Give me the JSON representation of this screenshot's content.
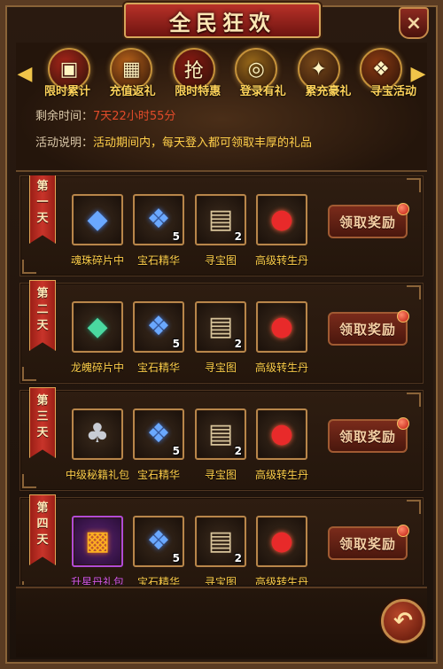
{
  "title": "全民狂欢",
  "close_glyph": "×",
  "nav": {
    "prev_glyph": "◀",
    "next_glyph": "▶"
  },
  "activities": [
    {
      "label": "限时累计",
      "icon": "chest-icon",
      "glyph": "▣",
      "color": "#a8251a"
    },
    {
      "label": "充值返礼",
      "icon": "gift-box-icon",
      "glyph": "▦",
      "color": "#b8621a"
    },
    {
      "label": "限时特惠",
      "icon": "sale-icon",
      "glyph": "抢",
      "color": "#8a1a12"
    },
    {
      "label": "登录有礼",
      "icon": "gold-coin-icon",
      "glyph": "◎",
      "color": "#9a6a1a"
    },
    {
      "label": "累充豪礼",
      "icon": "treasure-pile-icon",
      "glyph": "✦",
      "color": "#7a4a1a"
    },
    {
      "label": "寻宝活动",
      "icon": "treasure-bag-icon",
      "glyph": "❖",
      "color": "#8a3a12"
    }
  ],
  "remaining": {
    "label": "剩余时间：",
    "value": "7天22小时55分"
  },
  "description": {
    "label": "活动说明：",
    "value": "活动期间内，每天登入都可领取丰厚的礼品"
  },
  "days": [
    {
      "day_chars": [
        "第",
        "一",
        "天"
      ],
      "claim_label": "领取奖励",
      "items": [
        {
          "name": "魂珠碎片中",
          "icon": "blue-crystal-shard-icon",
          "glyph": "◆",
          "gclass": "g-crystal",
          "count": "",
          "purple": false
        },
        {
          "name": "宝石精华",
          "icon": "blue-gem-cluster-icon",
          "glyph": "❖",
          "gclass": "g-crystal",
          "count": "5",
          "purple": false
        },
        {
          "name": "寻宝图",
          "icon": "treasure-map-scroll-icon",
          "glyph": "▤",
          "gclass": "g-scroll",
          "count": "2",
          "purple": false
        },
        {
          "name": "高级转生丹",
          "icon": "red-orb-pill-icon",
          "glyph": "●",
          "gclass": "g-orb",
          "count": "",
          "purple": false
        }
      ]
    },
    {
      "day_chars": [
        "第",
        "二",
        "天"
      ],
      "claim_label": "领取奖励",
      "items": [
        {
          "name": "龙魄碎片中",
          "icon": "green-crystal-shard-icon",
          "glyph": "◆",
          "gclass": "g-green",
          "count": "",
          "purple": false
        },
        {
          "name": "宝石精华",
          "icon": "blue-gem-cluster-icon",
          "glyph": "❖",
          "gclass": "g-crystal",
          "count": "5",
          "purple": false
        },
        {
          "name": "寻宝图",
          "icon": "treasure-map-scroll-icon",
          "glyph": "▤",
          "gclass": "g-scroll",
          "count": "2",
          "purple": false
        },
        {
          "name": "高级转生丹",
          "icon": "red-orb-pill-icon",
          "glyph": "●",
          "gclass": "g-orb",
          "count": "",
          "purple": false
        }
      ]
    },
    {
      "day_chars": [
        "第",
        "三",
        "天"
      ],
      "claim_label": "领取奖励",
      "items": [
        {
          "name": "中级秘籍礼包",
          "icon": "silver-bag-icon",
          "glyph": "♣",
          "gclass": "g-bag",
          "count": "",
          "purple": false
        },
        {
          "name": "宝石精华",
          "icon": "blue-gem-cluster-icon",
          "glyph": "❖",
          "gclass": "g-crystal",
          "count": "5",
          "purple": false
        },
        {
          "name": "寻宝图",
          "icon": "treasure-map-scroll-icon",
          "glyph": "▤",
          "gclass": "g-scroll",
          "count": "2",
          "purple": false
        },
        {
          "name": "高级转生丹",
          "icon": "red-orb-pill-icon",
          "glyph": "●",
          "gclass": "g-orb",
          "count": "",
          "purple": false
        }
      ]
    },
    {
      "day_chars": [
        "第",
        "四",
        "天"
      ],
      "claim_label": "领取奖励",
      "items": [
        {
          "name": "升星丹礼包",
          "icon": "gold-gift-box-icon",
          "glyph": "▩",
          "gclass": "g-gift",
          "count": "",
          "purple": true
        },
        {
          "name": "宝石精华",
          "icon": "blue-gem-cluster-icon",
          "glyph": "❖",
          "gclass": "g-crystal",
          "count": "5",
          "purple": false
        },
        {
          "name": "寻宝图",
          "icon": "treasure-map-scroll-icon",
          "glyph": "▤",
          "gclass": "g-scroll",
          "count": "2",
          "purple": false
        },
        {
          "name": "高级转生丹",
          "icon": "red-orb-pill-icon",
          "glyph": "●",
          "gclass": "g-orb",
          "count": "",
          "purple": false
        }
      ]
    }
  ],
  "back_glyph": "↶"
}
